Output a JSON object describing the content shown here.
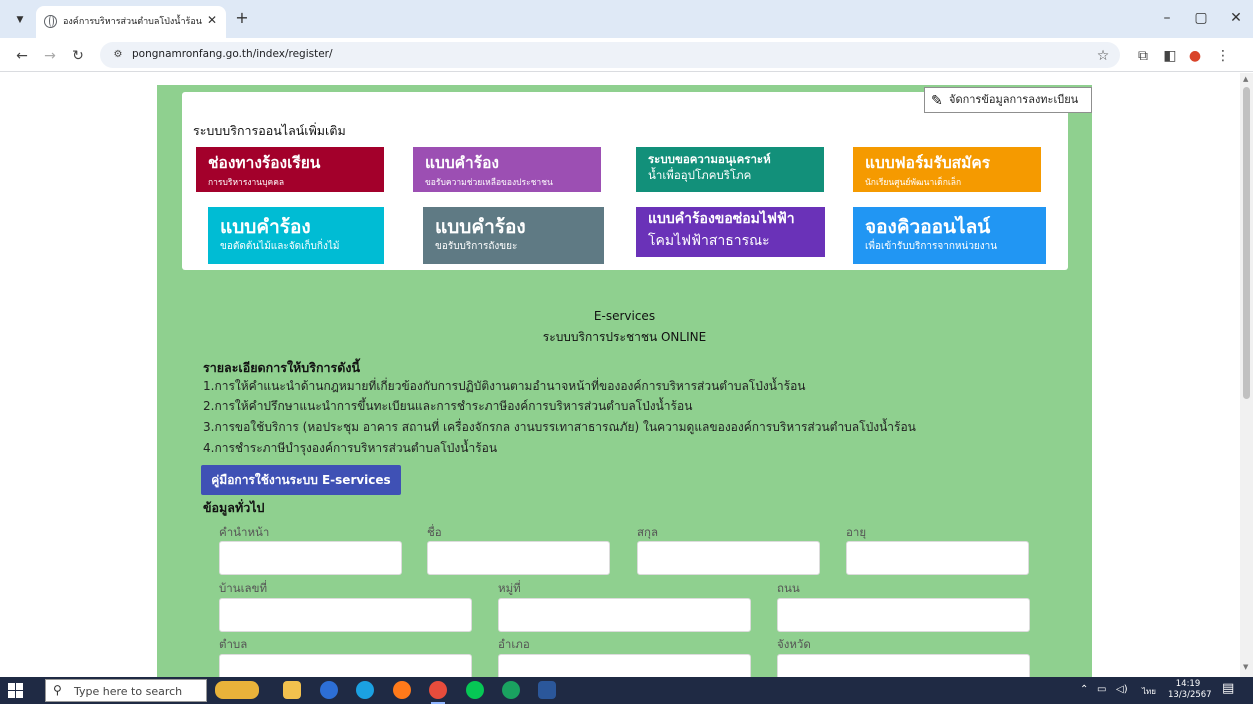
{
  "browser": {
    "tab_title": "องค์การบริหารส่วนตำบลโป่งน้ำร้อน อ",
    "tab_close": "✕",
    "new_tab": "+",
    "url": "pongnamronfang.go.th/index/register/",
    "window_controls": {
      "minimize": "–",
      "restore": "▢",
      "close": "✕"
    }
  },
  "page": {
    "manage_button": "จัดการข้อมูลการลงทะเบียน",
    "section_title": "ระบบบริการออนไลน์เพิ่มเติม",
    "services": [
      {
        "line1": "ช่องทางร้องเรียน",
        "line2": "การบริหารงานบุคคล",
        "color": "#a3002b"
      },
      {
        "line1": "แบบคำร้อง",
        "line2": "ขอรับความช่วยเหลือของประชาชน",
        "color": "#9c4fb3"
      },
      {
        "line1": "ระบบขอความอนุเคราะห์",
        "line2": "น้ำเพื่ออุปโภคบริโภค",
        "color": "#12907a"
      },
      {
        "line1": "แบบฟอร์มรับสมัคร",
        "line2": "นักเรียนศูนย์พัฒนาเด็กเล็ก",
        "color": "#f59a00"
      },
      {
        "line1": "แบบคำร้อง",
        "line2": "ขอตัดต้นไม้และจัดเก็บกิ่งไม้",
        "color": "#00bcd4"
      },
      {
        "line1": "แบบคำร้อง",
        "line2": "ขอรับบริการถังขยะ",
        "color": "#5f7a84"
      },
      {
        "line1": "แบบคำร้องขอซ่อมไฟฟ้า",
        "line2": "โคมไฟฟ้าสาธารณะ",
        "color": "#6a32b8"
      },
      {
        "line1": "จองคิวออนไลน์",
        "line2": "เพื่อเข้ารับบริการจากหน่วยงาน",
        "color": "#2196f3"
      }
    ],
    "eservices_title": "E-services",
    "eservices_subtitle": "ระบบบริการประชาชน ONLINE",
    "details_heading": "รายละเอียดการให้บริการดังนี้",
    "details": [
      "1.การให้คำแนะนำด้านกฎหมายที่เกี่ยวข้องกับการปฏิบัติงานตามอำนาจหน้าที่ขององค์การบริหารส่วนตำบลโป่งน้ำร้อน",
      "2.การให้คำปรึกษาแนะนำการขึ้นทะเบียนและการชำระภาษีองค์การบริหารส่วนตำบลโป่งน้ำร้อน",
      "3.การขอใช้บริการ (หอประชุม อาคาร สถานที่ เครื่องจักรกล งานบรรเทาสาธารณภัย) ในความดูแลขององค์การบริหารส่วนตำบลโป่งน้ำร้อน",
      "4.การชำระภาษีบำรุงองค์การบริหารส่วนตำบลโป่งน้ำร้อน"
    ],
    "manual_button": "คู่มือการใช้งานระบบ E-services",
    "general_heading": "ข้อมูลทั่วไป",
    "form_labels": {
      "prefix": "คำนำหน้า",
      "first_name": "ชื่อ",
      "last_name": "สกุล",
      "age": "อายุ",
      "house_no": "บ้านเลขที่",
      "moo": "หมู่ที่",
      "road": "ถนน",
      "subdistrict": "ตำบล",
      "district": "อำเภอ",
      "province": "จังหวัด"
    }
  },
  "taskbar": {
    "search_placeholder": "Type here to search",
    "language": "ไทย",
    "time": "14:19",
    "date": "13/3/2567"
  }
}
